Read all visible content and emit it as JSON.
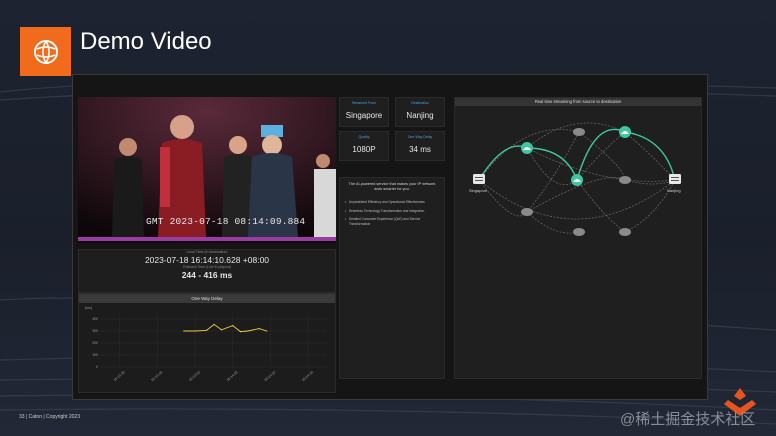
{
  "slide": {
    "title": "Demo Video",
    "footer": "33 | Caton | Copyright 2023",
    "watermark": "@稀土掘金技术社区"
  },
  "video": {
    "timestamp_overlay": "GMT 2023-07-18 08:14:09.884"
  },
  "time_panel": {
    "label_top": "Local Time (In destination)",
    "local_time": "2023-07-18 16:14:10.628 +08:00",
    "label_mid": "Rollback Time (Live to playout)",
    "latency_range": "244 - 416 ms"
  },
  "chart_panel": {
    "title": "One Way Delay",
    "ylabel": "(ms)"
  },
  "chart_data": {
    "type": "line",
    "title": "One Way Delay",
    "ylabel": "(ms)",
    "ytick_labels": [
      "400",
      "300",
      "200",
      "100",
      "0"
    ],
    "ylim": [
      0,
      450
    ],
    "xtick_labels": [
      "16:13:30",
      "16:13:40",
      "16:13:50",
      "16:14:00",
      "16:14:10",
      "16:14:20"
    ],
    "series": [
      {
        "color": "#e8d23a",
        "x": [
          "16:13:47",
          "16:13:50",
          "16:13:53",
          "16:13:55",
          "16:13:57",
          "16:14:00",
          "16:14:02",
          "16:14:04",
          "16:14:07",
          "16:14:09"
        ],
        "values": [
          300,
          300,
          305,
          355,
          310,
          345,
          295,
          300,
          320,
          300
        ]
      }
    ],
    "grid": true,
    "legend": "none"
  },
  "info_cards": [
    {
      "label": "Streamed From",
      "value": "Singapore"
    },
    {
      "label": "Destination",
      "value": "Nanjing"
    },
    {
      "label": "Quality",
      "value": "1080P"
    },
    {
      "label": "One-Way Delay",
      "value": "34 ms"
    }
  ],
  "description": {
    "heading": "The AI-powered service that makes your IP network work smarter for you.",
    "items": [
      "Unparalleled Efficiency and Operational Effectiveness",
      "Seamless Technology Transformation and Integration",
      "Detailed Consumer Experience (QoE) and Service Transformation"
    ]
  },
  "network": {
    "title": "Real time streaming from source to destination",
    "source_label": "Singapore",
    "destination_label": "Nanjing",
    "colors": {
      "active": "#3ec7a0",
      "inactive": "#7b7b7b"
    }
  }
}
